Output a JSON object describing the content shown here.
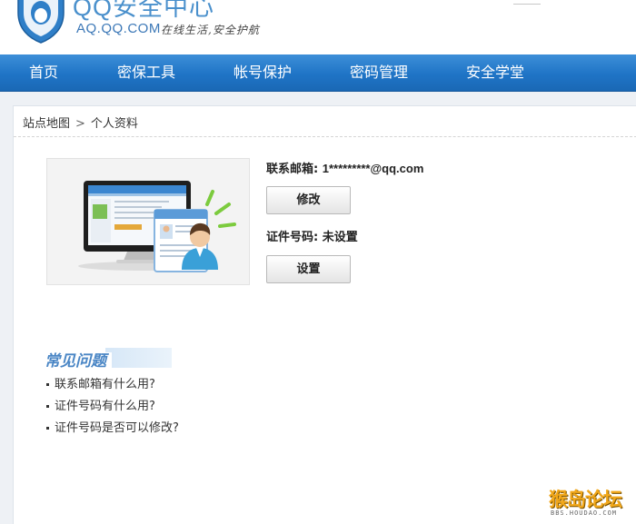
{
  "header": {
    "brand_title": "QQ安全中心",
    "domain": "AQ.QQ.COM",
    "slogan": "在线生活,安全护航"
  },
  "nav": {
    "items": [
      {
        "label": "首页"
      },
      {
        "label": "密保工具"
      },
      {
        "label": "帐号保护"
      },
      {
        "label": "密码管理"
      },
      {
        "label": "安全学堂"
      }
    ]
  },
  "breadcrumb": {
    "items": [
      "站点地图",
      "个人资料"
    ],
    "separator": ">"
  },
  "profile": {
    "email_label": "联系邮箱:",
    "email_value": "1*********@qq.com",
    "modify_button": "修改",
    "id_label": "证件号码:",
    "id_value": "未设置",
    "set_button": "设置"
  },
  "faq": {
    "title": "常见问题",
    "items": [
      "联系邮箱有什么用?",
      "证件号码有什么用?",
      "证件号码是否可以修改?"
    ]
  },
  "watermark": {
    "text": "猴岛论坛",
    "sub": "BBS.HOUDAO.COM"
  },
  "colors": {
    "nav_blue": "#1f74c6",
    "brand_blue": "#4a90cc",
    "faq_title_blue": "#4a86c5",
    "page_bg": "#eef1f5"
  }
}
